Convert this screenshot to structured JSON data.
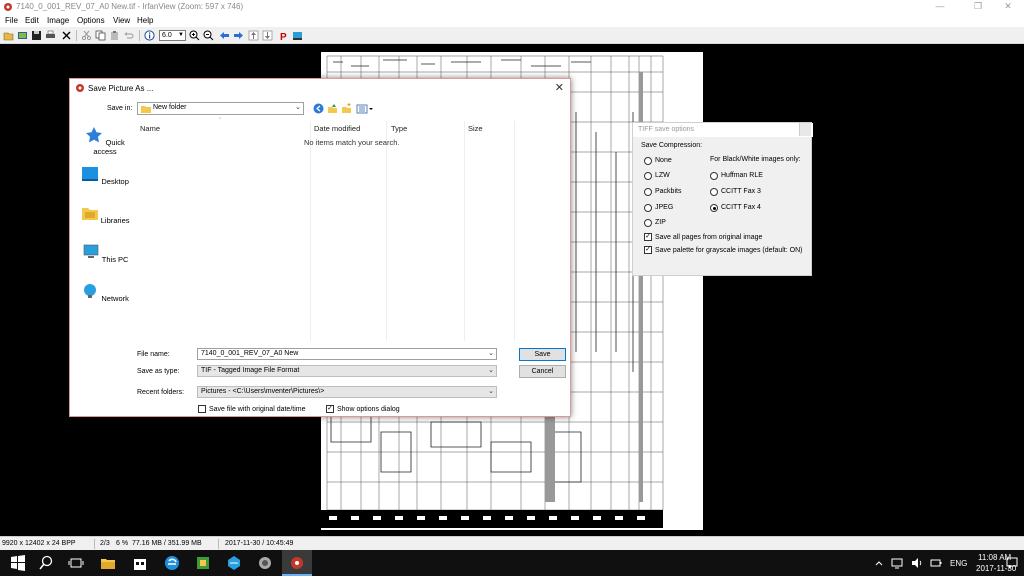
{
  "window": {
    "title": "7140_0_001_REV_07_A0 New.tif - IrfanView (Zoom: 597 x 746)"
  },
  "menu": [
    "File",
    "Edit",
    "Image",
    "Options",
    "View",
    "Help"
  ],
  "toolbar": {
    "zoom_value": "6.0"
  },
  "status": {
    "resolution": "9920 x 12402 x 24 BPP",
    "page": "2/3",
    "zoom": "6 %",
    "memory": "77.16 MB / 351.99 MB",
    "datetime": "2017-11-30 / 10:45:49"
  },
  "save_dialog": {
    "title": "Save Picture As ...",
    "save_in_label": "Save in:",
    "save_in_value": "New folder",
    "places": [
      "Quick access",
      "Desktop",
      "Libraries",
      "This PC",
      "Network"
    ],
    "columns": [
      "Name",
      "Date modified",
      "Type",
      "Size"
    ],
    "empty_message": "No items match your search.",
    "file_name_label": "File name:",
    "file_name_value": "7140_0_001_REV_07_A0 New",
    "save_as_type_label": "Save as type:",
    "save_as_type_value": "TIF - Tagged Image File Format",
    "recent_folders_label": "Recent folders:",
    "recent_folders_value": "Pictures  -  <C:\\Users\\mventer\\Pictures\\>",
    "save_button": "Save",
    "cancel_button": "Cancel",
    "keep_date_label": "Save file with original date/time",
    "keep_date_checked": false,
    "show_options_label": "Show options dialog",
    "show_options_checked": true
  },
  "tiff_options": {
    "title": "TIFF save options",
    "compression_label": "Save Compression:",
    "bw_label": "For Black/White images only:",
    "compression_options": [
      {
        "label": "None",
        "selected": false
      },
      {
        "label": "LZW",
        "selected": false
      },
      {
        "label": "Packbits",
        "selected": false
      },
      {
        "label": "JPEG",
        "selected": false
      },
      {
        "label": "ZIP",
        "selected": false
      }
    ],
    "bw_options": [
      {
        "label": "Huffman RLE",
        "selected": false
      },
      {
        "label": "CCITT Fax 3",
        "selected": false
      },
      {
        "label": "CCITT Fax 4",
        "selected": true
      }
    ],
    "save_all_pages_label": "Save all pages from original image",
    "save_all_pages_checked": true,
    "save_palette_label": "Save palette for grayscale images (default: ON)",
    "save_palette_checked": true
  },
  "taskbar": {
    "time": "11:08 AM",
    "date": "2017-11-30",
    "language": "ENG"
  }
}
